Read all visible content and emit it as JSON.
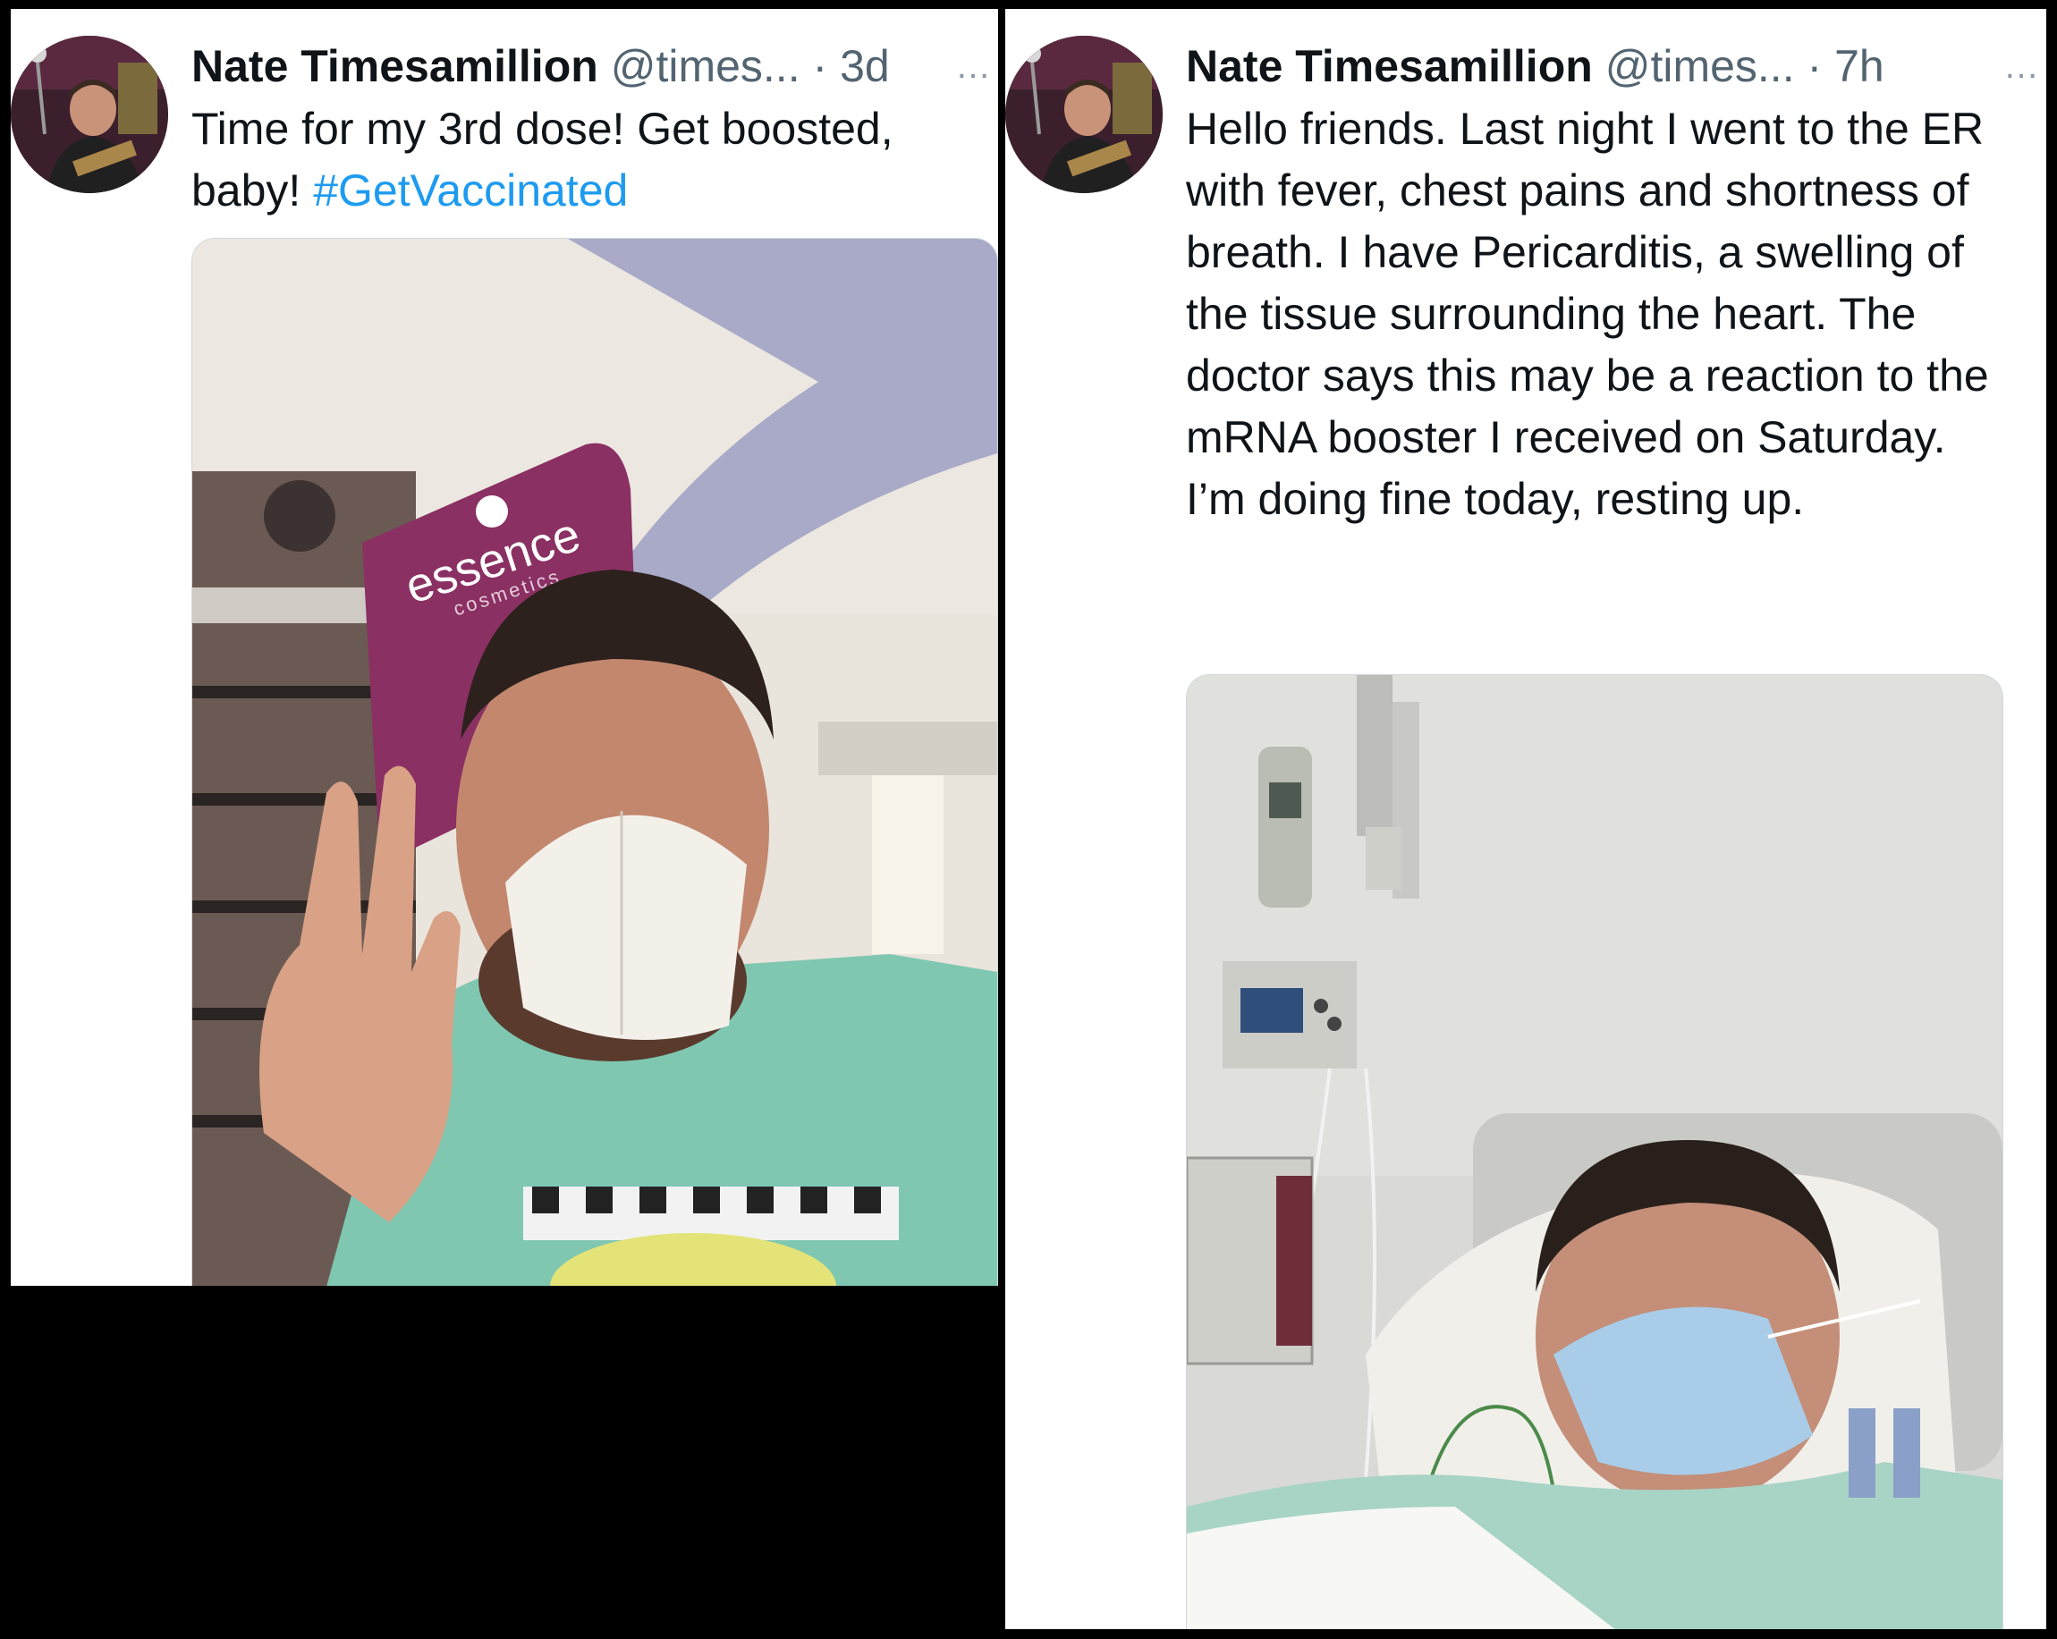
{
  "tweets": [
    {
      "display_name": "Nate Timesamillion",
      "handle": "@times...",
      "separator": "·",
      "time": "3d",
      "more_icon": "…",
      "text": "Time for my 3rd dose! Get boosted, baby!",
      "hashtag": "#GetVaccinated",
      "media": {
        "sign_brand": "essence",
        "sign_sub": "cosmetics"
      }
    },
    {
      "display_name": "Nate Timesamillion",
      "handle": "@times...",
      "separator": "·",
      "time": "7h",
      "more_icon": "…",
      "text": "Hello friends. Last night I went to the ER with fever, chest pains and shortness of breath. I have Pericarditis, a swelling of the tissue surrounding the heart. The doctor says this may be a reaction to the mRNA booster I received on Saturday. I’m doing fine today, resting up."
    }
  ],
  "colors": {
    "name": "#0f1419",
    "secondary": "#536471",
    "hashtag": "#1d9bf0",
    "background": "#000000",
    "card": "#ffffff"
  }
}
